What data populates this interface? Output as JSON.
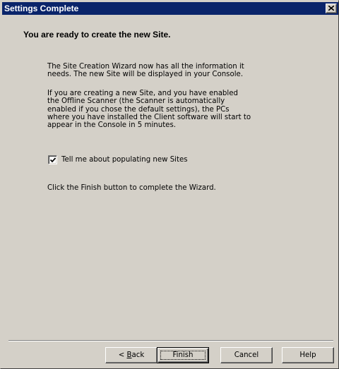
{
  "window": {
    "title": "Settings Complete",
    "close_icon": "close-icon"
  },
  "content": {
    "heading": "You are ready to create the new Site.",
    "paragraph1": [
      "The Site Creation Wizard now has all the information it",
      "needs. The new Site will be displayed in your Console."
    ],
    "paragraph2": [
      "If you are creating a new Site, and you have enabled",
      "the Offline Scanner (the Scanner is automatically",
      "enabled if you chose the default settings), the PCs",
      "where you have installed the Client software will start to",
      "appear in the Console in 5 minutes."
    ],
    "checkbox": {
      "label": "Tell me about populating new Sites",
      "checked": true
    },
    "finish_instruction": "Click the Finish button to complete the Wizard."
  },
  "buttons": {
    "back_prefix": "< ",
    "back_mnemonic": "B",
    "back_rest": "ack",
    "finish": "Finish",
    "cancel": "Cancel",
    "help": "Help"
  },
  "colors": {
    "titlebar": "#0a246a",
    "dialog_face": "#d4d0c8"
  }
}
